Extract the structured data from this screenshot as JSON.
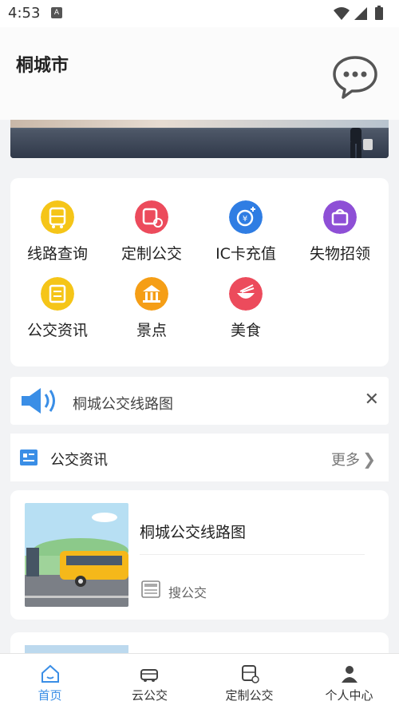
{
  "status_bar": {
    "time": "4:53",
    "notification_icon": "A"
  },
  "header": {
    "city": "桐城市",
    "chat_icon": "chat-bubble-icon"
  },
  "grid": [
    {
      "label": "线路查询",
      "color": "#f5c518",
      "icon": "bus-icon"
    },
    {
      "label": "定制公交",
      "color": "#ec4b5c",
      "icon": "custom-bus-icon"
    },
    {
      "label": "IC卡充值",
      "color": "#2f7de3",
      "icon": "card-recharge-icon"
    },
    {
      "label": "失物招领",
      "color": "#8e4fd6",
      "icon": "lost-found-icon"
    },
    {
      "label": "公交资讯",
      "color": "#f5c518",
      "icon": "news-icon"
    },
    {
      "label": "景点",
      "color": "#f59e16",
      "icon": "landmark-icon"
    },
    {
      "label": "美食",
      "color": "#ec4b5c",
      "icon": "food-icon"
    }
  ],
  "notice": {
    "text": "桐城公交线路图"
  },
  "news": {
    "header": "公交资讯",
    "more": "更多",
    "items": [
      {
        "title": "桐城公交线路图",
        "source": "搜公交"
      }
    ]
  },
  "tabs": [
    {
      "label": "首页",
      "icon": "home-icon",
      "active": true
    },
    {
      "label": "云公交",
      "icon": "cloud-bus-icon",
      "active": false
    },
    {
      "label": "定制公交",
      "icon": "custom-bus-icon",
      "active": false
    },
    {
      "label": "个人中心",
      "icon": "person-icon",
      "active": false
    }
  ],
  "colors": {
    "accent": "#3a8ee6",
    "notice_icon": "#3a8ee6"
  }
}
